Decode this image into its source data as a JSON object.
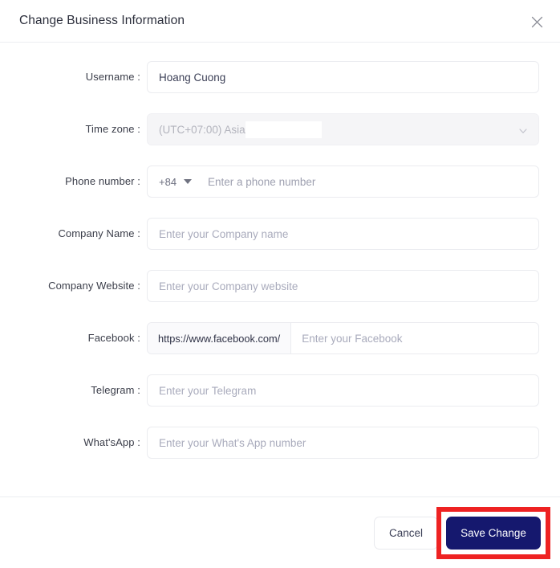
{
  "dialog": {
    "title": "Change Business Information",
    "close_icon": "close-icon"
  },
  "form": {
    "fields": [
      {
        "key": "username",
        "label": "Username :",
        "type": "text",
        "value": "Hoang Cuong",
        "placeholder": ""
      },
      {
        "key": "timezone",
        "label": "Time zone :",
        "type": "select-disabled",
        "value": "(UTC+07:00) Asia/",
        "chevron_icon": "chevron-down-icon"
      },
      {
        "key": "phone",
        "label": "Phone number :",
        "type": "phone",
        "dial_code": "+84",
        "caret_icon": "caret-down-icon",
        "placeholder": "Enter a phone number",
        "value": ""
      },
      {
        "key": "company_name",
        "label": "Company Name :",
        "type": "text",
        "value": "",
        "placeholder": "Enter your Company name"
      },
      {
        "key": "company_website",
        "label": "Company Website :",
        "type": "text",
        "value": "",
        "placeholder": "Enter your Company website"
      },
      {
        "key": "facebook",
        "label": "Facebook :",
        "type": "prefix",
        "prefix": "https://www.facebook.com/",
        "value": "",
        "placeholder": "Enter your Facebook"
      },
      {
        "key": "telegram",
        "label": "Telegram :",
        "type": "text",
        "value": "",
        "placeholder": "Enter your Telegram"
      },
      {
        "key": "whatsapp",
        "label": "What'sApp :",
        "type": "text",
        "value": "",
        "placeholder": "Enter your What's App number"
      }
    ]
  },
  "footer": {
    "cancel_label": "Cancel",
    "save_label": "Save Change"
  },
  "colors": {
    "primary": "#15186e",
    "annotation": "#ee2222",
    "label_text": "#3b3e4a",
    "placeholder": "#a9abbc",
    "disabled_bg": "#f5f5f7"
  }
}
